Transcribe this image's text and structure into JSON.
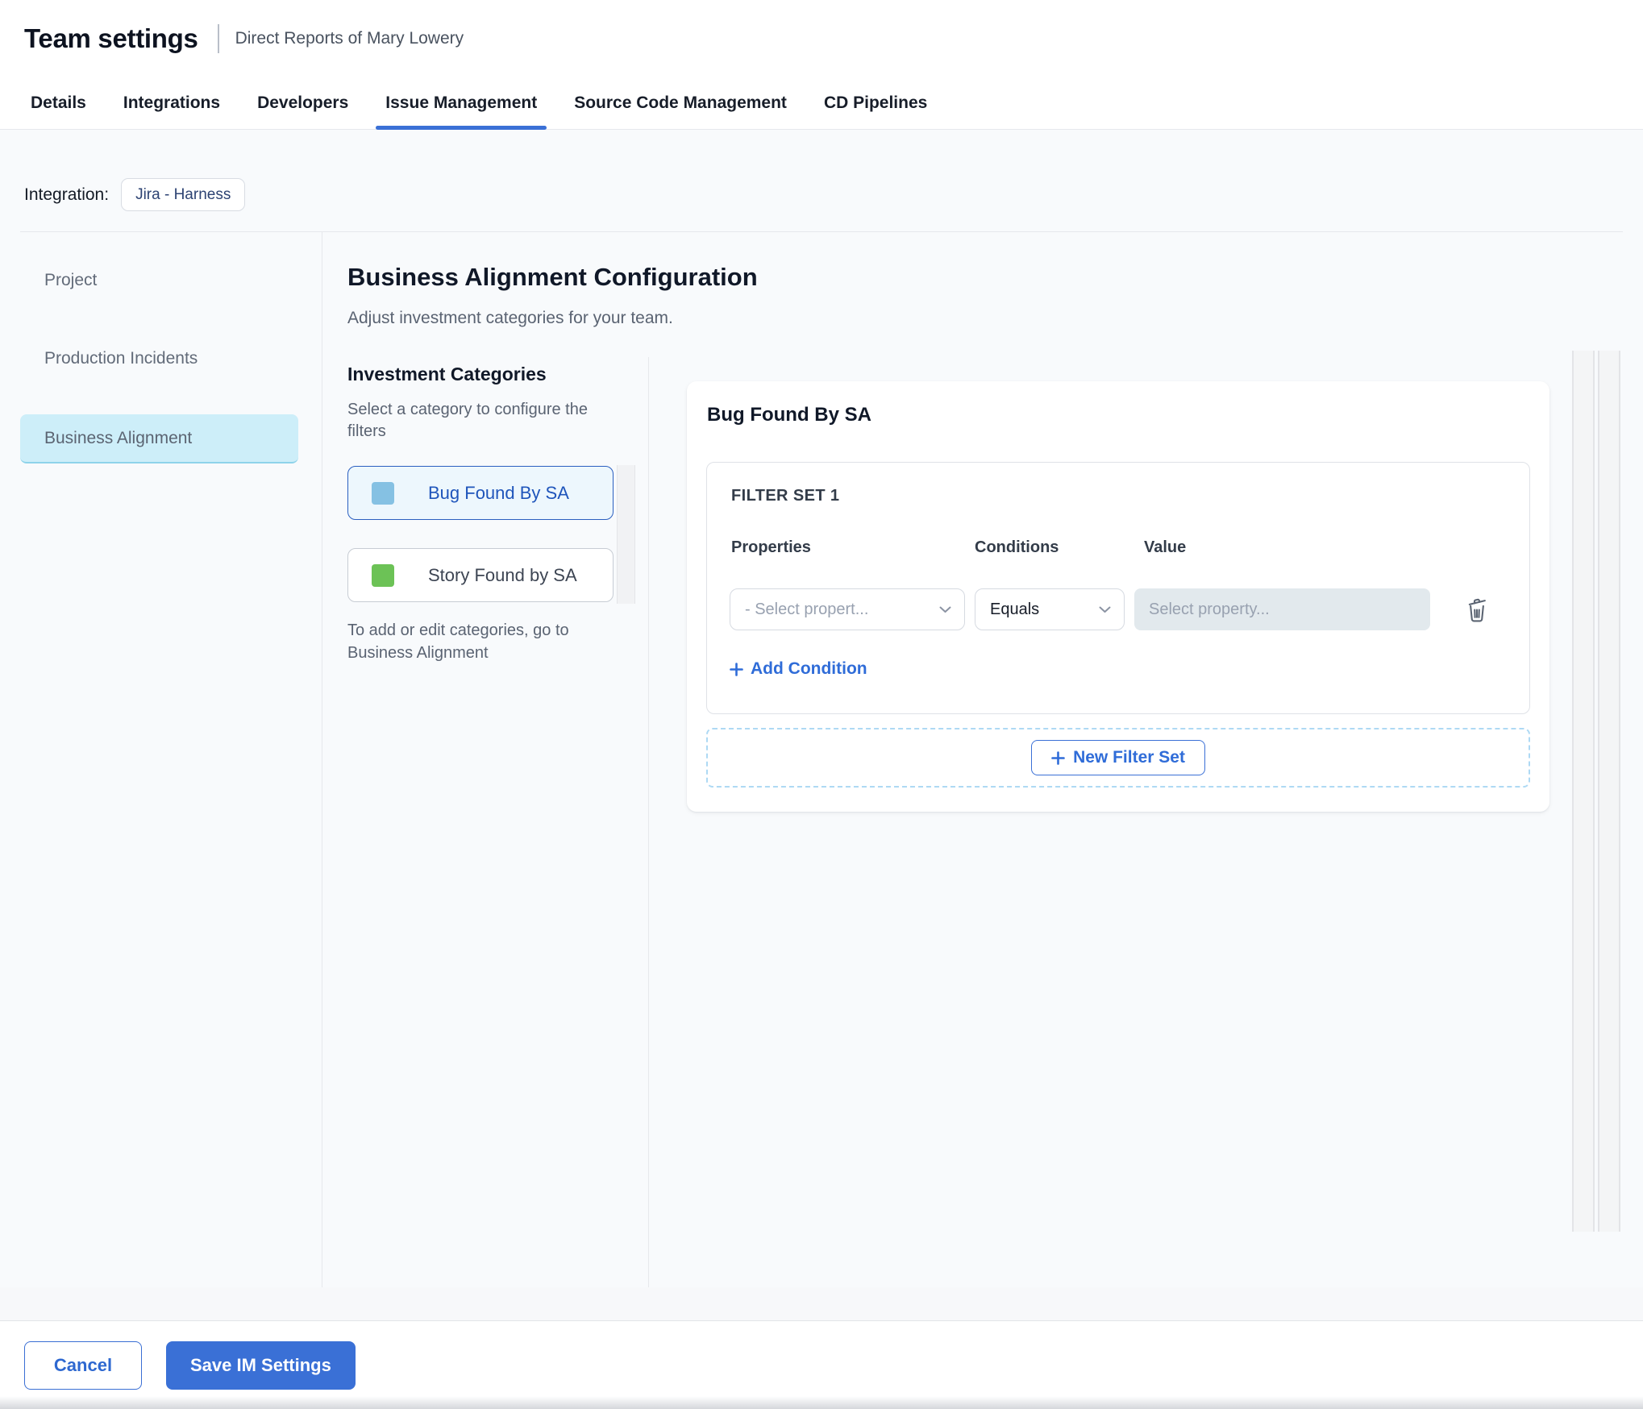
{
  "header": {
    "title": "Team settings",
    "subtitle": "Direct Reports of Mary Lowery"
  },
  "tabs": [
    {
      "label": "Details",
      "active": false
    },
    {
      "label": "Integrations",
      "active": false
    },
    {
      "label": "Developers",
      "active": false
    },
    {
      "label": "Issue Management",
      "active": true
    },
    {
      "label": "Source Code Management",
      "active": false
    },
    {
      "label": "CD Pipelines",
      "active": false
    }
  ],
  "integration": {
    "label": "Integration:",
    "chip": "Jira - Harness"
  },
  "sidebar": {
    "items": [
      {
        "label": "Project",
        "selected": false
      },
      {
        "label": "Production Incidents",
        "selected": false
      },
      {
        "label": "Business Alignment",
        "selected": true
      }
    ]
  },
  "main": {
    "heading": "Business Alignment Configuration",
    "subheading": "Adjust investment categories for your team.",
    "categories_panel": {
      "title": "Investment Categories",
      "hint": "Select a category to configure the filters",
      "items": [
        {
          "label": "Bug Found By SA",
          "swatch_color": "#85c1e3",
          "selected": true
        },
        {
          "label": "Story Found by SA",
          "swatch_color": "#6cc256",
          "selected": false
        }
      ],
      "footnote": "To add or edit categories, go to Business Alignment"
    },
    "filter_panel": {
      "title": "Bug Found By SA",
      "filter_set_label": "FILTER SET 1",
      "columns": [
        "Properties",
        "Conditions",
        "Value"
      ],
      "property_select_value": "- Select propert...",
      "condition_select_value": "Equals",
      "value_placeholder": "Select property...",
      "add_condition_label": "Add Condition",
      "new_filter_set_label": "New Filter Set"
    }
  },
  "footer": {
    "cancel_label": "Cancel",
    "save_label": "Save IM Settings"
  },
  "colors": {
    "accent": "#3a70d6",
    "link": "#2f6cd8",
    "tab_underline": "#3b74da",
    "sidebar_selected_bg": "#cdeef9",
    "selected_category_bg": "#edf7fd",
    "selected_category_border": "#2b5fc0",
    "category_blue_swatch": "#85c1e3",
    "category_green_swatch": "#6cc256",
    "value_input_bg": "#e2e9ed",
    "dashed_border": "#aed9f4"
  }
}
